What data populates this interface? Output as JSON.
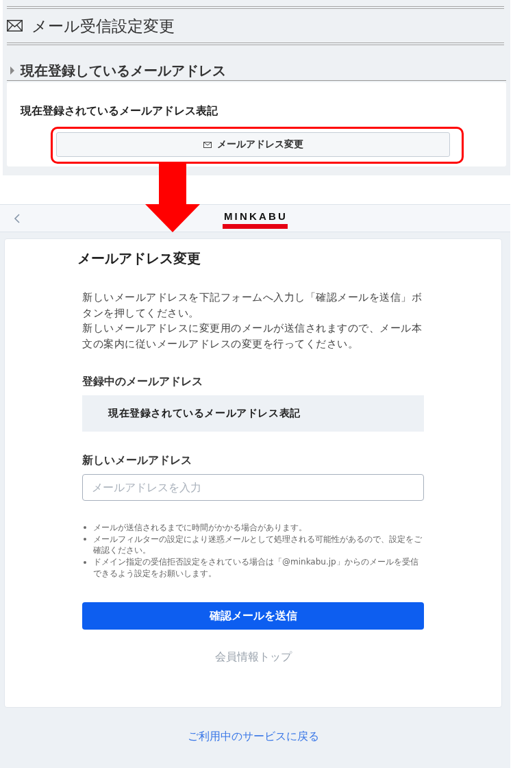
{
  "top_page": {
    "title": "メール受信設定変更",
    "section_heading": "現在登録しているメールアドレス",
    "current_address": "現在登録されているメールアドレス表記",
    "change_button": {
      "label": "メールアドレス変更",
      "highlighted": true
    }
  },
  "transition_arrow": true,
  "bottom_page": {
    "header": {
      "logo": "MINKABU"
    },
    "title": "メールアドレス変更",
    "description": [
      "新しいメールアドレスを下記フォームへ入力し「確認メールを送信」ボタンを押してください。",
      "新しいメールアドレスに変更用のメールが送信されますので、メール本文の案内に従いメールアドレスの変更を行ってください。"
    ],
    "current_label": "登録中のメールアドレス",
    "current_value": "現在登録されているメールアドレス表記",
    "new_label": "新しいメールアドレス",
    "new_address": {
      "placeholder": "メールアドレスを入力"
    },
    "notes": [
      "メールが送信されるまでに時間がかかる場合があります。",
      "メールフィルターの設定により迷惑メールとして処理される可能性があるので、設定をご確認ください。",
      "ドメイン指定の受信拒否設定をされている場合は「@minkabu.jp」からのメールを受信できるよう設定をお願いします。"
    ],
    "submit_button": "確認メールを送信",
    "member_top_link": "会員情報トップ",
    "return_link": "ご利用中のサービスに戻る"
  }
}
